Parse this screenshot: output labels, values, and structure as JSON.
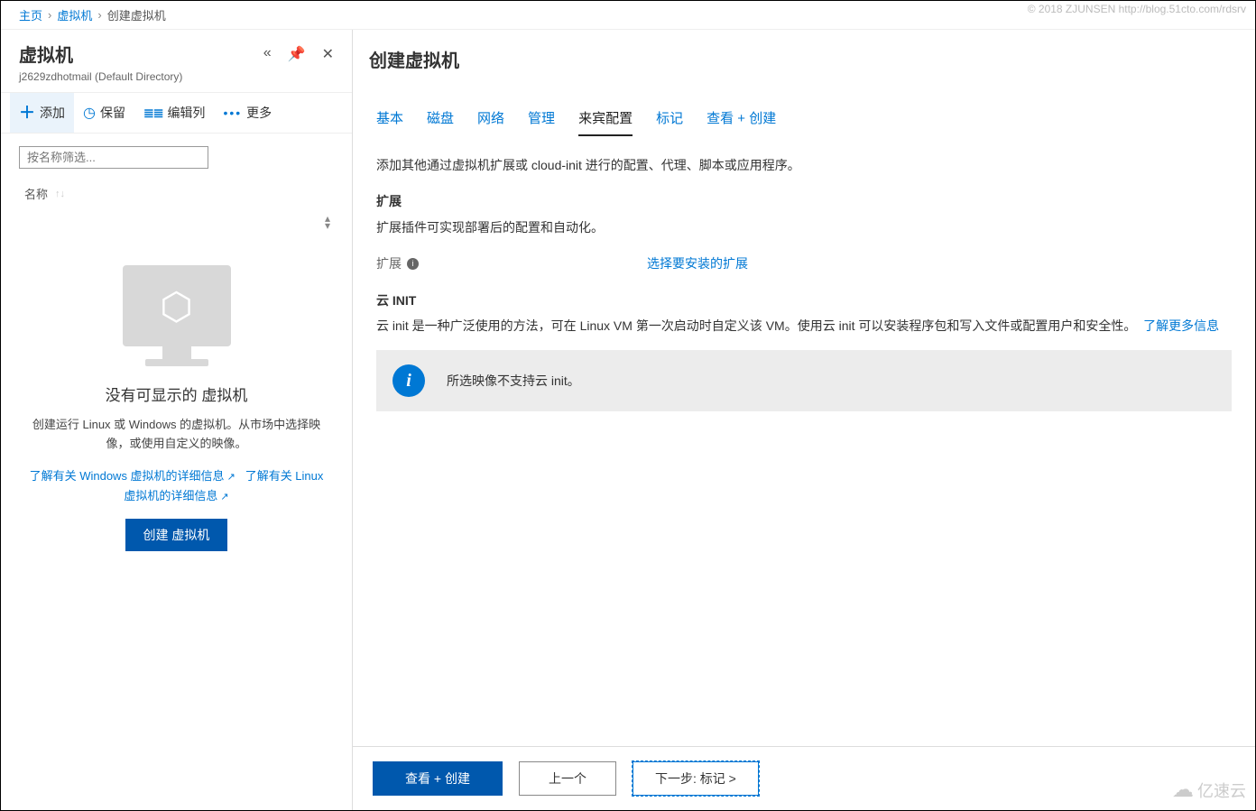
{
  "watermark": "© 2018 ZJUNSEN http://blog.51cto.com/rdsrv",
  "breadcrumb": {
    "home": "主页",
    "vm": "虚拟机",
    "create": "创建虚拟机"
  },
  "leftPanel": {
    "title": "虚拟机",
    "subtitle": "j2629zdhotmail (Default Directory)",
    "toolbar": {
      "add": "添加",
      "keep": "保留",
      "editCols": "编辑列",
      "more": "更多"
    },
    "filterPlaceholder": "按名称筛选...",
    "nameHeader": "名称",
    "empty": {
      "title": "没有可显示的 虚拟机",
      "desc": "创建运行 Linux 或 Windows 的虚拟机。从市场中选择映像，或使用自定义的映像。",
      "linkWin": "了解有关 Windows 虚拟机的详细信息",
      "linkLinux": "了解有关 Linux 虚拟机的详细信息",
      "createBtn": "创建 虚拟机"
    }
  },
  "rightPanel": {
    "title": "创建虚拟机",
    "tabs": {
      "basic": "基本",
      "disk": "磁盘",
      "network": "网络",
      "manage": "管理",
      "guest": "来宾配置",
      "tags": "标记",
      "review": "查看 + 创建"
    },
    "intro": "添加其他通过虚拟机扩展或 cloud-init 进行的配置、代理、脚本或应用程序。",
    "ext": {
      "heading": "扩展",
      "desc": "扩展插件可实现部署后的配置和自动化。",
      "label": "扩展",
      "link": "选择要安装的扩展"
    },
    "cloudinit": {
      "heading": "云 INIT",
      "desc": "云 init 是一种广泛使用的方法，可在 Linux VM 第一次启动时自定义该 VM。使用云 init 可以安装程序包和写入文件或配置用户和安全性。",
      "learn": "了解更多信息",
      "banner": "所选映像不支持云 init。"
    },
    "footer": {
      "review": "查看 + 创建",
      "prev": "上一个",
      "next": "下一步: 标记 >"
    }
  },
  "logoText": "亿速云"
}
